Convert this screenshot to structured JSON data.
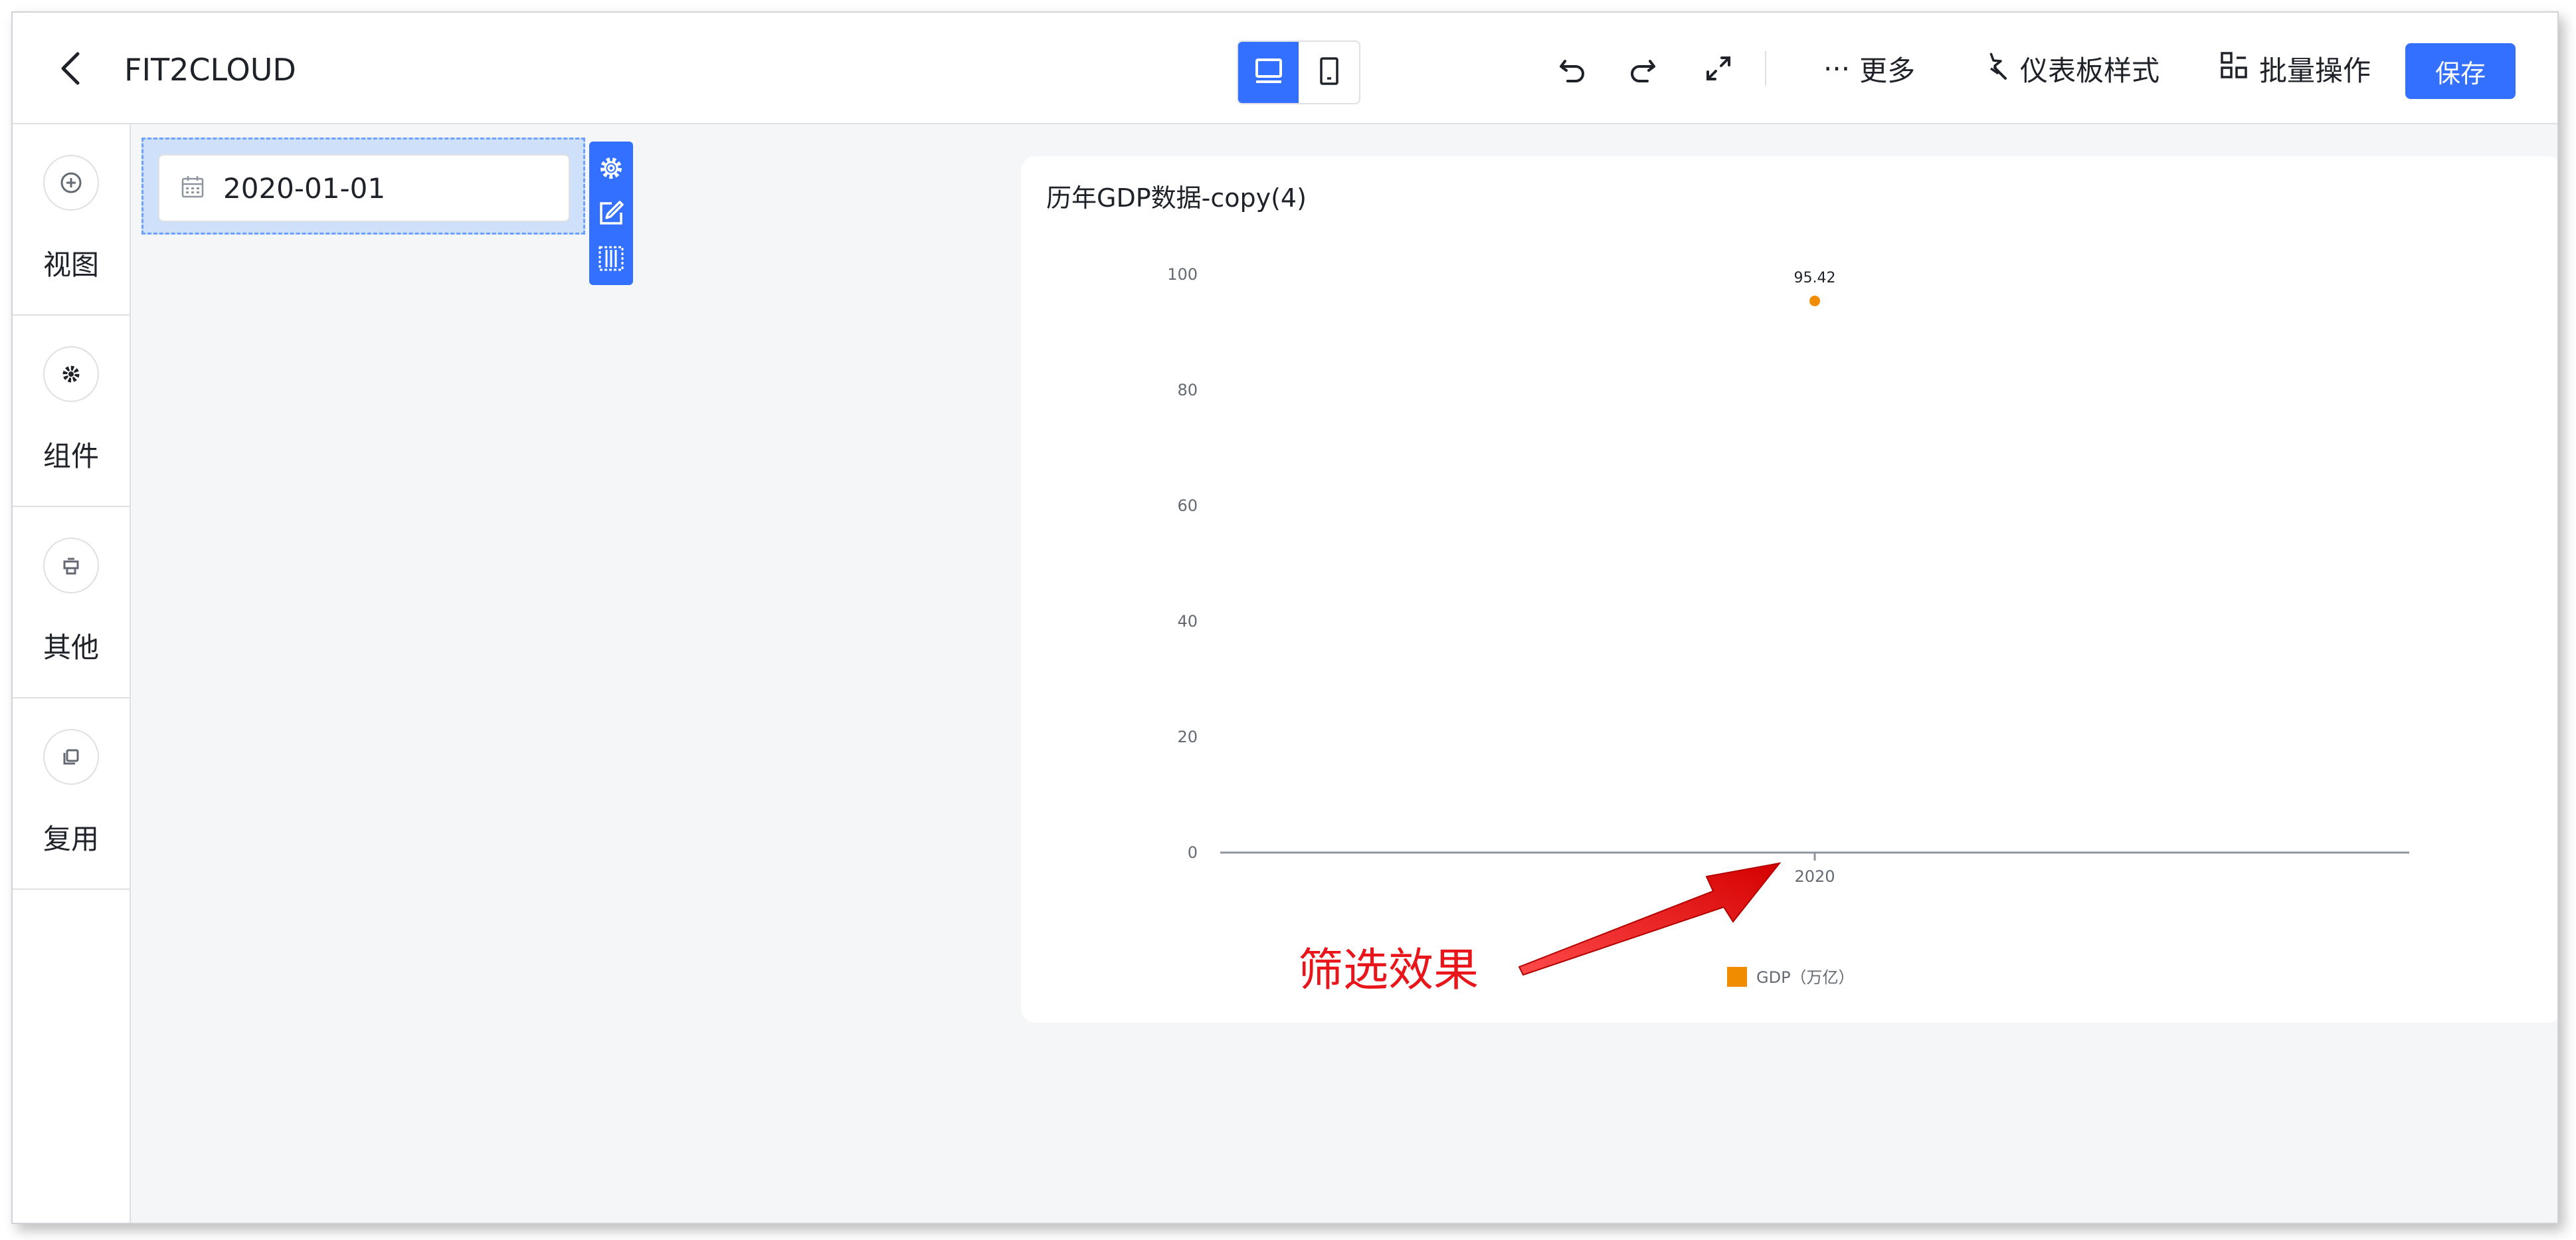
{
  "header": {
    "title": "FIT2CLOUD",
    "more_label": "更多",
    "style_label": "仪表板样式",
    "batch_label": "批量操作",
    "save_label": "保存"
  },
  "sidebar": {
    "items": [
      {
        "label": "视图",
        "icon": "plus-circle-icon"
      },
      {
        "label": "组件",
        "icon": "gear-icon"
      },
      {
        "label": "其他",
        "icon": "other-icon"
      },
      {
        "label": "复用",
        "icon": "copy-icon"
      }
    ]
  },
  "filter": {
    "date_value": "2020-01-01"
  },
  "chart": {
    "title": "历年GDP数据-copy(4)"
  },
  "chart_data": {
    "type": "scatter",
    "title": "历年GDP数据-copy(4)",
    "categories": [
      "2020"
    ],
    "series": [
      {
        "name": "GDP（万亿）",
        "values": [
          95.42
        ],
        "color": "#f08c00"
      }
    ],
    "ylim": [
      0,
      100
    ],
    "yticks": [
      0,
      20,
      40,
      60,
      80,
      100
    ],
    "data_labels": [
      "95.42"
    ],
    "legend_position": "bottom",
    "grid": false
  },
  "annotation": {
    "text": "筛选效果",
    "color": "#e8151b"
  },
  "colors": {
    "accent": "#3370ff",
    "series": "#f08c00"
  }
}
